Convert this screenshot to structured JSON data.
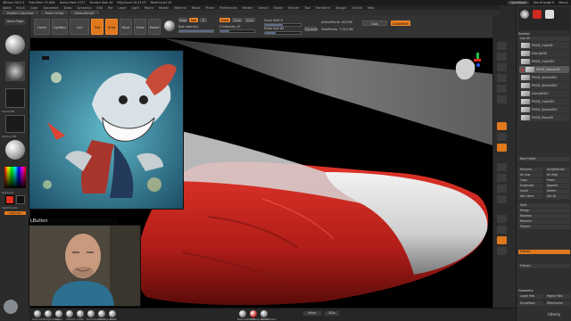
{
  "titlebar": {
    "app": "ZBrush 2021.5",
    "items": [
      "Free Mem 25.8GB",
      "Active Mem 5727",
      "Scratch Disk 49",
      "PolyCount 10.53 KP",
      "MeshCount 44"
    ],
    "quicksave": "QuickSave",
    "see_through": "See-through 0",
    "menus": "Menus"
  },
  "menubar": {
    "items": [
      "Alpha",
      "Brush",
      "Color",
      "Document",
      "Draw",
      "Dynamics",
      "Edit",
      "File",
      "Layer",
      "Light",
      "Macro",
      "Marker",
      "Material",
      "Movie",
      "Picker",
      "Preferences",
      "Render",
      "Stencil",
      "Stroke",
      "Texture",
      "Tool",
      "Transform",
      "Zplugin",
      "Zscript",
      "Help"
    ]
  },
  "toolbar": {
    "items": [
      "Enable Customize",
      "Store Config",
      "DefaultScript"
    ]
  },
  "left_shelf": {
    "home_page": "Home Page",
    "lightbox": "LightBox",
    "live_boolean": "Live Boolean",
    "alpha_off": "Alpha Off",
    "texture_off": "Texture Off",
    "gradient": "Gradient",
    "switch_color": "SwitchColor",
    "alternate": "Alternate"
  },
  "top_tools": {
    "edit": "Edit",
    "draw": "Draw",
    "move": "Move",
    "scale": "Scale",
    "rotate": "Rotate",
    "mrgb": "Mrgb",
    "rgb": "Rgb",
    "m": "M",
    "zadd": "Zadd",
    "zsub": "Zsub",
    "zcut": "Zcut",
    "rgb_intensity": "Rgb Intensity",
    "z_intensity": "Z Intensity 25",
    "focal_shift": "Focal Shift 0",
    "draw_size": "Draw Size 64",
    "dynamic": "Dynamic",
    "active_points": "ActivePoints: 49,096",
    "total_points": "TotalPoints: 7.314 Mil",
    "quickmesh": "QuickMesh",
    "dots_label": "Dots"
  },
  "reference_window": {
    "label": "LButton"
  },
  "right_panel": {
    "title": "Subtool",
    "list_label": "List All",
    "subtools": [
      "PM3D_Cube3D",
      "Extrude3D",
      "PM3D_Cube3D1",
      "PM3D_Sphere3D",
      "PM3D_Sphere3D1",
      "PM3D_Sphere3D2",
      "Extrude3D1",
      "PM3D_Cube3D2",
      "PM3D_Sphere3D3",
      "PM3D_Plane3D"
    ],
    "new_folder": "New Folder",
    "rename": "Rename",
    "autoreorder": "AutoReorder",
    "all_low": "All Low",
    "all_high": "All High",
    "copy": "Copy",
    "paste": "Paste",
    "duplicate": "Duplicate",
    "append": "Append",
    "insert": "Insert",
    "delete": "Delete",
    "del_other": "Del Other",
    "del_all": "Del All",
    "split": "Split",
    "merge": "Merge",
    "boolean": "Boolean",
    "remesh": "Remesh",
    "project": "Project",
    "extract": "Extract",
    "geometry": "Geometry",
    "lower_res": "Lower Res",
    "higher_res": "Higher Res",
    "dynamesh": "DynaMesh",
    "zremesher": "ZRemesher"
  },
  "bottom_bar": {
    "brushes": [
      "Standard",
      "ClayBuildup",
      "Move",
      "hPolish",
      "Inflat",
      "DamStandard",
      "TrimDynamic",
      "Pinch"
    ],
    "mirror": "Mirror",
    "subdiv_label": "SDiv",
    "materials": [
      "BasicMaterial",
      "MatCap Red01",
      "SkinShade4"
    ],
    "watermark": "Udemy"
  },
  "viewport_colors": {
    "background": "#000000",
    "cloth_red": "#cc2a22",
    "cloth_white": "#dedede"
  }
}
